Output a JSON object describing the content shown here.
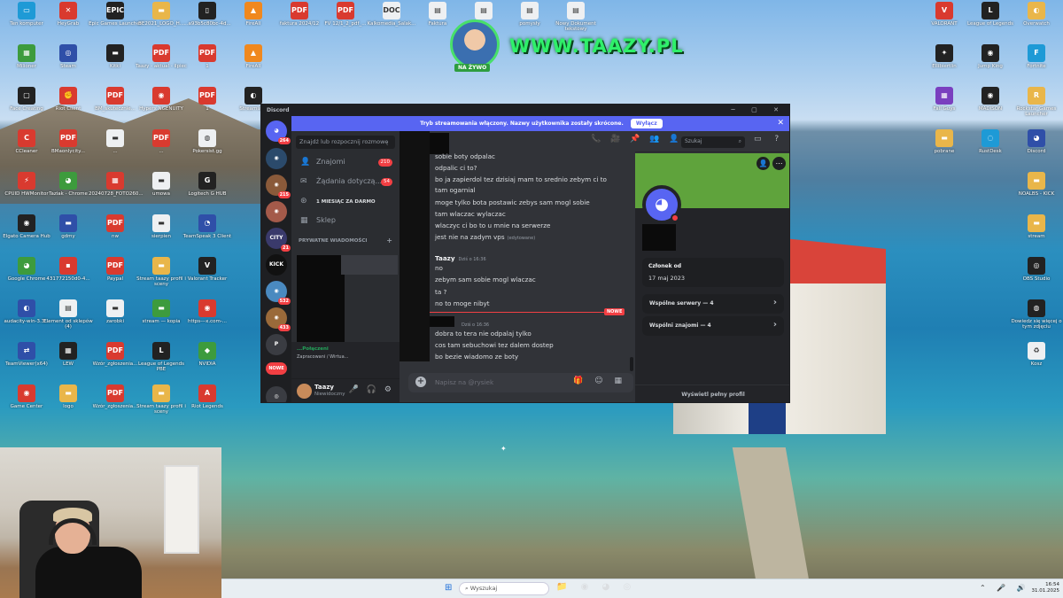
{
  "overlay": {
    "live_badge": "NA ŻYWO",
    "site_text": "WWW.TAAZY.PL"
  },
  "desktop_icons": [
    {
      "label": "Ten komputer",
      "style": "c",
      "glyph": "▭"
    },
    {
      "label": "HeyGrab",
      "style": "r",
      "glyph": "✕"
    },
    {
      "label": "Epic Games Launcher",
      "style": "k",
      "glyph": "EPIC"
    },
    {
      "label": "BE2021_LOGO_H...",
      "style": "y",
      "glyph": "▬"
    },
    {
      "label": "...a93b5c80bc-4d...",
      "style": "k",
      "glyph": "▯"
    },
    {
      "label": "FireAll",
      "style": "o",
      "glyph": "▲"
    },
    {
      "label": "faktura 2024/12",
      "style": "r",
      "glyph": "PDF"
    },
    {
      "label": "FV 12/1_2_pdf_...",
      "style": "r",
      "glyph": "PDF"
    },
    {
      "label": "Kalkomedia_Salak...",
      "style": "w",
      "glyph": "DOC"
    },
    {
      "label": "Faktura",
      "style": "w",
      "glyph": "▤"
    },
    {
      "label": "",
      "style": "w",
      "glyph": "▤"
    },
    {
      "label": "pomysły",
      "style": "w",
      "glyph": "▤"
    },
    {
      "label": "Nowy Dokument tekstowy",
      "style": "w",
      "glyph": "▤"
    },
    {
      "label": "Milioner",
      "style": "g2",
      "glyph": "▦"
    },
    {
      "label": "Steam",
      "style": "b",
      "glyph": "◎"
    },
    {
      "label": "Kitki",
      "style": "k",
      "glyph": "▬"
    },
    {
      "label": "Taazy - aktual - ilpiec",
      "style": "r",
      "glyph": "PDF"
    },
    {
      "label": "1",
      "style": "r",
      "glyph": "PDF"
    },
    {
      "label": "FireAll",
      "style": "o",
      "glyph": "▲"
    },
    {
      "label": "Face Creating",
      "style": "k",
      "glyph": "▢"
    },
    {
      "label": "Riot Client",
      "style": "r",
      "glyph": "✊"
    },
    {
      "label": "BM_skutecznie...",
      "style": "r",
      "glyph": "PDF"
    },
    {
      "label": "Hyperx NGENUITY",
      "style": "r",
      "glyph": "◉"
    },
    {
      "label": "1",
      "style": "r",
      "glyph": "PDF"
    },
    {
      "label": "Streamlabs",
      "style": "k",
      "glyph": "◐"
    },
    {
      "label": "CCleaner",
      "style": "r",
      "glyph": "C"
    },
    {
      "label": "BMaonlycity...",
      "style": "r",
      "glyph": "PDF"
    },
    {
      "label": "...",
      "style": "w",
      "glyph": "▬"
    },
    {
      "label": "...",
      "style": "r",
      "glyph": "PDF"
    },
    {
      "label": "Pokersist.gg",
      "style": "w",
      "glyph": "◍"
    },
    {
      "label": "CPUID HWMonitor",
      "style": "r",
      "glyph": "⚡"
    },
    {
      "label": "Taziak - Chrome",
      "style": "g2",
      "glyph": "◕"
    },
    {
      "label": "20240728_FOTO260...",
      "style": "r",
      "glyph": "▦"
    },
    {
      "label": "umowa",
      "style": "w",
      "glyph": "▬"
    },
    {
      "label": "Logitech G HUB",
      "style": "k",
      "glyph": "G"
    },
    {
      "label": "Elgato Camera Hub",
      "style": "k",
      "glyph": "◉"
    },
    {
      "label": "gdmy",
      "style": "b",
      "glyph": "▬"
    },
    {
      "label": "nw",
      "style": "r",
      "glyph": "PDF"
    },
    {
      "label": "sierpien",
      "style": "w",
      "glyph": "▬"
    },
    {
      "label": "TeamSpeak 3 Client",
      "style": "b",
      "glyph": "◔"
    },
    {
      "label": "Google Chrome",
      "style": "g2",
      "glyph": "◕"
    },
    {
      "label": "431772150d0-4...",
      "style": "r",
      "glyph": "▪"
    },
    {
      "label": "Paypal",
      "style": "r",
      "glyph": "PDF"
    },
    {
      "label": "Stream taazy profil i sceny",
      "style": "y",
      "glyph": "▬"
    },
    {
      "label": "Valorant Tracker",
      "style": "k",
      "glyph": "V"
    },
    {
      "label": "audacity-win-3.3...",
      "style": "b",
      "glyph": "◐"
    },
    {
      "label": "Element od sklepów (4)",
      "style": "w",
      "glyph": "▤"
    },
    {
      "label": "zarobki",
      "style": "w",
      "glyph": "▬"
    },
    {
      "label": "stream — kopia",
      "style": "g2",
      "glyph": "▬"
    },
    {
      "label": "https---x.com-...",
      "style": "r",
      "glyph": "◉"
    },
    {
      "label": "TeamViewer(x64)",
      "style": "b",
      "glyph": "⇄"
    },
    {
      "label": "LEW",
      "style": "k",
      "glyph": "▦"
    },
    {
      "label": "Wzór_zgłoszenia...",
      "style": "r",
      "glyph": "PDF"
    },
    {
      "label": "League of Legends PBE",
      "style": "k",
      "glyph": "L"
    },
    {
      "label": "NVIDIA",
      "style": "g2",
      "glyph": "◆"
    },
    {
      "label": "Game Center",
      "style": "r",
      "glyph": "◉"
    },
    {
      "label": "logo",
      "style": "y",
      "glyph": "▬"
    },
    {
      "label": "Wzór_zgłoszenia...",
      "style": "r",
      "glyph": "PDF"
    },
    {
      "label": "Stream taazy profil i sceny",
      "style": "y",
      "glyph": "▬"
    },
    {
      "label": "Riot Legends",
      "style": "r",
      "glyph": "A"
    },
    {
      "label": "VALORANT",
      "style": "r",
      "glyph": "V"
    },
    {
      "label": "League of Legends",
      "style": "k",
      "glyph": "L"
    },
    {
      "label": "Overwatch",
      "style": "y",
      "glyph": "◐"
    },
    {
      "label": "Ellibiertlin",
      "style": "k",
      "glyph": "✦"
    },
    {
      "label": "Jump King",
      "style": "k",
      "glyph": "◉"
    },
    {
      "label": "Fortnite",
      "style": "c",
      "glyph": "F"
    },
    {
      "label": "Fall Guys",
      "style": "p",
      "glyph": "▦"
    },
    {
      "label": "MADISON",
      "style": "k",
      "glyph": "◉"
    },
    {
      "label": "Rockstar Games Launcher",
      "style": "y",
      "glyph": "R"
    },
    {
      "label": "pobrane",
      "style": "y",
      "glyph": "▬"
    },
    {
      "label": "RustDesk",
      "style": "c",
      "glyph": "◌"
    },
    {
      "label": "Discord",
      "style": "b",
      "glyph": "◕"
    },
    {
      "label": "NOALBS - KICK",
      "style": "y",
      "glyph": "▬"
    },
    {
      "label": "stream",
      "style": "y",
      "glyph": "▬"
    },
    {
      "label": "OBS Studio",
      "style": "k",
      "glyph": "◎"
    },
    {
      "label": "Dowiedz się więcej o tym zdjęciu",
      "style": "k",
      "glyph": "◍"
    },
    {
      "label": "Kosz",
      "style": "w",
      "glyph": "♻"
    }
  ],
  "discord": {
    "window_title": "Discord",
    "window_controls": "─ ▢ ✕",
    "banner": {
      "text": "Tryb streamowania włączony. Nazwy użytkownika zostały skrócone.",
      "button": "Wyłącz",
      "close": "✕"
    },
    "servers": [
      {
        "glyph": "◕",
        "badge": "264"
      },
      {
        "glyph": "◉",
        "badge": ""
      },
      {
        "glyph": "◉",
        "badge": "215"
      },
      {
        "glyph": "◉",
        "badge": ""
      },
      {
        "glyph": "CITY",
        "badge": "21"
      },
      {
        "glyph": "KICK",
        "badge": ""
      },
      {
        "glyph": "◉",
        "badge": "532"
      },
      {
        "glyph": "◉",
        "badge": "433"
      },
      {
        "glyph": "P",
        "badge": ""
      },
      {
        "glyph": "NOWE",
        "badge": ""
      },
      {
        "glyph": "◎",
        "badge": ""
      }
    ],
    "dm_search_placeholder": "Znajdź lub rozpocznij rozmowę",
    "dm_nav": [
      {
        "icon": "👤",
        "label": "Znajomi",
        "count": "210"
      },
      {
        "icon": "✉",
        "label": "Żądania dotyczą...",
        "count": "54"
      },
      {
        "icon": "⊛",
        "label": "1 MIESIĄC ZA DARMO",
        "count": ""
      },
      {
        "icon": "▦",
        "label": "Sklep",
        "count": ""
      }
    ],
    "dm_header": "PRYWATNE WIADOMOŚCI",
    "dm_header_plus": "+",
    "voice": {
      "status": "...Połączeni",
      "sub": "Zapracowani / Wirtua..."
    },
    "user": {
      "name": "Taazy",
      "status": "Niewidoczny",
      "controls": "🎤 🎧 ⚙"
    },
    "messages_a": [
      {
        "text": "sobie boty odpalac",
        "edited": ""
      },
      {
        "text": "odpalic ci to?",
        "edited": ""
      },
      {
        "text": "bo ja zapierdol tez dzisiaj mam to srednio zebym ci to",
        "edited": ""
      },
      {
        "text": "tam ogarnial",
        "edited": ""
      },
      {
        "text": "moge tylko bota postawic zebys sam mogl sobie",
        "edited": ""
      },
      {
        "text": "tam wlaczac wylaczac",
        "edited": ""
      },
      {
        "text": "wlaczyc ci bo to u mnie na serwerze",
        "edited": ""
      },
      {
        "text": "jest nie na zadym vps",
        "edited": "(edytowane)"
      }
    ],
    "author_b": {
      "name": "Taazy",
      "ts": "Dziś o 16:36"
    },
    "messages_b": [
      "no",
      "zebym sam sobie mogl wlaczac",
      "ta ?",
      "no to moge nibyt"
    ],
    "new_tag": "NOWE",
    "author_c_ts": "Dziś o 16:36",
    "messages_c": [
      "dobra to tera nie odpalaj tylko",
      "cos tam sebuchowi tez dalem dostep",
      "bo bezie wiadomo ze boty"
    ],
    "composer_placeholder": "Napisz na @rysiek",
    "composer_icons": "🎁 ☺ ▦",
    "header_icons": "📞 🎥 📌 👥 👤",
    "header_search_placeholder": "Szukaj",
    "header_right_icons": "▭ ?",
    "profile": {
      "member_since_label": "Członek od",
      "member_since": "17 maj 2023",
      "mutual_servers": "Wspólne serwery — 4",
      "mutual_friends": "Wspólni znajomi — 4",
      "view_full": "Wyświetl pełny profil",
      "colors": {
        "banner": "#5fa33c",
        "status": "#f23f43"
      }
    }
  },
  "taskbar": {
    "search_placeholder": "Wyszukaj",
    "start_glyph": "⊞",
    "apps": "📁 ◉ ◕ ◎",
    "tray": "⌃ 🎤 🔊",
    "time": "16:54",
    "date": "31.01.2025"
  }
}
